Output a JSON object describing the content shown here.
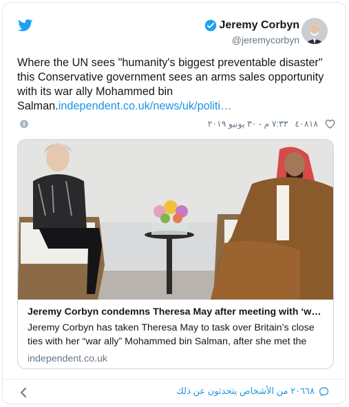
{
  "author": {
    "name": "Jeremy Corbyn",
    "handle": "@jeremycorbyn"
  },
  "tweet": {
    "text": "Where the UN sees \"humanity's biggest preventable disaster\" this Conservative government sees an arms sales opportunity with its war ally Mohammed bin Salman.",
    "link": "independent.co.uk/news/uk/politi…"
  },
  "meta": {
    "likes": "٤٠٨١٨",
    "timestamp": "٧:٣٣ م - ٣٠ يونيو ٢٠١٩"
  },
  "card": {
    "title": "Jeremy Corbyn condemns Theresa May after meeting with ‘w…",
    "description": "Jeremy Corbyn has taken Theresa May to task over Britain’s close ties with her “war ally” Mohammed bin Salman, after she met the",
    "domain": "independent.co.uk"
  },
  "footer": {
    "people_talking": "٢٠٦٦٨ من الأشخاص يتحدثون عن ذلك"
  },
  "colors": {
    "twitter_blue": "#1da1f2",
    "link_blue": "#1b95e0",
    "secondary_text": "#657786",
    "border": "#e1e8ed"
  },
  "icons": [
    "twitter-bird-icon",
    "verified-badge-icon",
    "info-icon",
    "heart-icon",
    "comment-icon",
    "chevron-left-icon"
  ]
}
